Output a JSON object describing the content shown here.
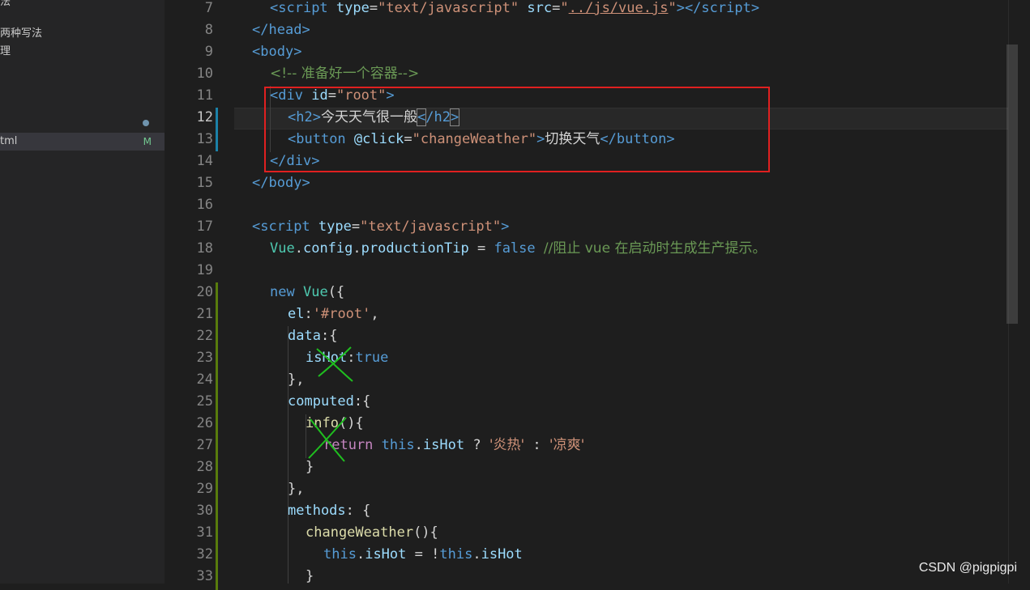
{
  "sidebar": {
    "items": [
      {
        "label": "法"
      },
      {
        "label": "两种写法"
      },
      {
        "label": "理"
      },
      {
        "label": "tml",
        "badge": "M"
      }
    ]
  },
  "editor": {
    "current_line": 12,
    "lines": [
      {
        "n": "7"
      },
      {
        "n": "8"
      },
      {
        "n": "9"
      },
      {
        "n": "10"
      },
      {
        "n": "11"
      },
      {
        "n": "12"
      },
      {
        "n": "13"
      },
      {
        "n": "14"
      },
      {
        "n": "15"
      },
      {
        "n": "16"
      },
      {
        "n": "17"
      },
      {
        "n": "18"
      },
      {
        "n": "19"
      },
      {
        "n": "20"
      },
      {
        "n": "21"
      },
      {
        "n": "22"
      },
      {
        "n": "23"
      },
      {
        "n": "24"
      },
      {
        "n": "25"
      },
      {
        "n": "26"
      },
      {
        "n": "27"
      },
      {
        "n": "28"
      },
      {
        "n": "29"
      },
      {
        "n": "30"
      },
      {
        "n": "31"
      },
      {
        "n": "32"
      },
      {
        "n": "33"
      }
    ],
    "code": {
      "l7_src": "../js/vue.js",
      "l7_type": "text/javascript",
      "l10_comment": "<!-- 准备好一个容器-->",
      "l11_id": "root",
      "l12_text": "今天天气很一般",
      "l13_click": "changeWeather",
      "l13_text": "切换天气",
      "l17_type": "text/javascript",
      "l18_comment": "//阻止 vue 在启动时生成生产提示。",
      "l21_el": "'#root'",
      "l27_hot": "'炎热'",
      "l27_cool": "'凉爽'"
    }
  },
  "colors": {
    "annotation": "#e02020",
    "cross_marks": "#1fbf1f"
  },
  "watermark": "CSDN @pigpigpi"
}
